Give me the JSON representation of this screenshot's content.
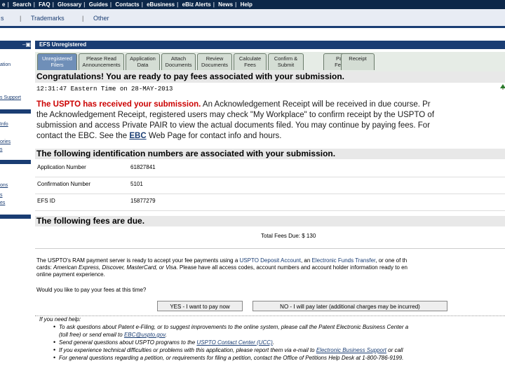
{
  "topnav": {
    "items": [
      "e",
      "Search",
      "FAQ",
      "Glossary",
      "Guides",
      "Contacts",
      "eBusiness",
      "eBiz Alerts",
      "News",
      "Help"
    ]
  },
  "subnav": {
    "items": [
      "s",
      "Trademarks",
      "Other"
    ]
  },
  "sidebar": {
    "items": [
      "ation",
      "s Support",
      "Info",
      "ories",
      "s",
      "ons",
      "s",
      "es"
    ]
  },
  "panel": {
    "title": "EFS Unregistered"
  },
  "tabs": [
    {
      "line1": "Unregistered",
      "line2": "Filers",
      "active": true
    },
    {
      "line1": "Please Read",
      "line2": "Announcements",
      "active": false
    },
    {
      "line1": "Application",
      "line2": "Data",
      "active": false
    },
    {
      "line1": "Attach",
      "line2": "Documents",
      "active": false
    },
    {
      "line1": "Review",
      "line2": "Documents",
      "active": false
    },
    {
      "line1": "Calculate",
      "line2": "Fees",
      "active": false
    },
    {
      "line1": "Confirm &",
      "line2": "Submit",
      "active": false
    },
    {
      "line1": "Pay",
      "line2": "Fees",
      "active": false
    },
    {
      "line1": "Receipt",
      "line2": "",
      "active": false
    }
  ],
  "congrats": "Congratulations! You are ready to pay fees associated with your submission.",
  "timestamp": "12:31:47 Eastern Time on 28-MAY-2013",
  "message": {
    "lead": "The USPTO has received your submission.",
    "line1_rest": " An Acknowledgement Receipt will be received in due course. Pr",
    "line2": "the Acknowledgement Receipt, registered users may check \"My Workplace\" to confirm receipt by the USPTO of",
    "line3": "submission and access Private PAIR to view the actual documents filed. You may continue by paying fees. For",
    "line4_pre": "contact the EBC. See the ",
    "line4_link": "EBC",
    "line4_post": " Web Page for contact info and hours."
  },
  "ids_heading": "The following identification numbers are associated with your submission.",
  "ids": [
    {
      "label": "Application Number",
      "value": "61827841"
    },
    {
      "label": "Confirmation Number",
      "value": "5101"
    },
    {
      "label": "EFS ID",
      "value": "15877279"
    }
  ],
  "fees_heading": "The following fees are due.",
  "total_fees": "Total Fees Due: $ 130",
  "payment": {
    "line1_pre": "The USPTO's RAM payment server is ready to accept your fee payments using a ",
    "line1_link1": "USPTO Deposit Account",
    "line1_mid": ", an ",
    "line1_link2": "Electronic Funds Transfer",
    "line1_post": ", or one of th",
    "line2_pre": "cards: ",
    "line2_cards": "American Express, Discover, MasterCard, or Visa.",
    "line2_post": " Please have all access codes, account numbers and account holder information ready to en",
    "line3": "online payment experience.",
    "question": "Would you like to pay your fees at this time?"
  },
  "buttons": {
    "yes": "YES - I want to pay now",
    "no": "NO - I will pay later (additional charges may be incurred)"
  },
  "help": {
    "heading": "If you need help:",
    "item1a": "To ask questions about Patent e-Filing, or to suggest improvements to the online system, please call the Patent Electronic Business Center a",
    "item1b_pre": "(toll free) or send email to ",
    "item1b_link": "EBC@uspto.gov",
    "item1b_post": ".",
    "item2_pre": "Send general questions about USPTO programs to the ",
    "item2_link": "USPTO Contact Center (UCC)",
    "item2_post": ".",
    "item3_pre": "If you experience technical difficulties or problems with this application, please report them via e-mail to ",
    "item3_link": "Electronic Business Support",
    "item3_post": " or call",
    "item4": "For general questions regarding a petition, or requirements for filing a petition, contact the Office of Petitions Help Desk at 1-800-786-9199."
  }
}
